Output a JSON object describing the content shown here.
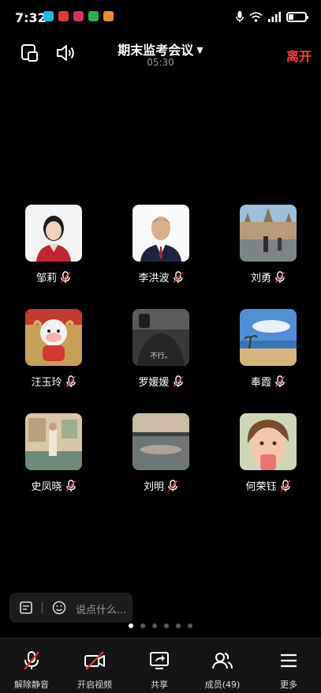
{
  "status_bar": {
    "time": "7:32",
    "app_icon_colors": [
      "#1fb8e8",
      "#e03a3a",
      "#d8345f",
      "#22b14c",
      "#f08a2c"
    ]
  },
  "header": {
    "title": "期末监考会议",
    "timer": "05:30",
    "leave_label": "离开"
  },
  "participants": [
    {
      "name": "邹莉",
      "muted": true,
      "avatar": "portrait-woman-red-bg"
    },
    {
      "name": "李洪波",
      "muted": true,
      "avatar": "portrait-man-white-bg"
    },
    {
      "name": "刘勇",
      "muted": true,
      "avatar": "building-photo"
    },
    {
      "name": "汪玉玲",
      "muted": true,
      "avatar": "cartoon-cow-toy"
    },
    {
      "name": "罗媛媛",
      "muted": true,
      "avatar": "dark-photo-text"
    },
    {
      "name": "奉霞",
      "muted": true,
      "avatar": "beach-photo"
    },
    {
      "name": "史凤晓",
      "muted": true,
      "avatar": "illustration-room"
    },
    {
      "name": "刘明",
      "muted": true,
      "avatar": "lake-sunset-photo"
    },
    {
      "name": "何荣钰",
      "muted": true,
      "avatar": "child-photo"
    }
  ],
  "avatar_texts": {
    "dark_photo": "不行。"
  },
  "chat": {
    "placeholder": "说点什么..."
  },
  "pagination": {
    "pages": 6,
    "active_index": 0
  },
  "toolbar": {
    "unmute_label": "解除静音",
    "video_label": "开启视频",
    "share_label": "共享",
    "members_label": "成员(49)",
    "more_label": "更多"
  },
  "colors": {
    "leave": "#ff3b30",
    "muted_slash": "#e03a3a",
    "background": "#000000"
  }
}
